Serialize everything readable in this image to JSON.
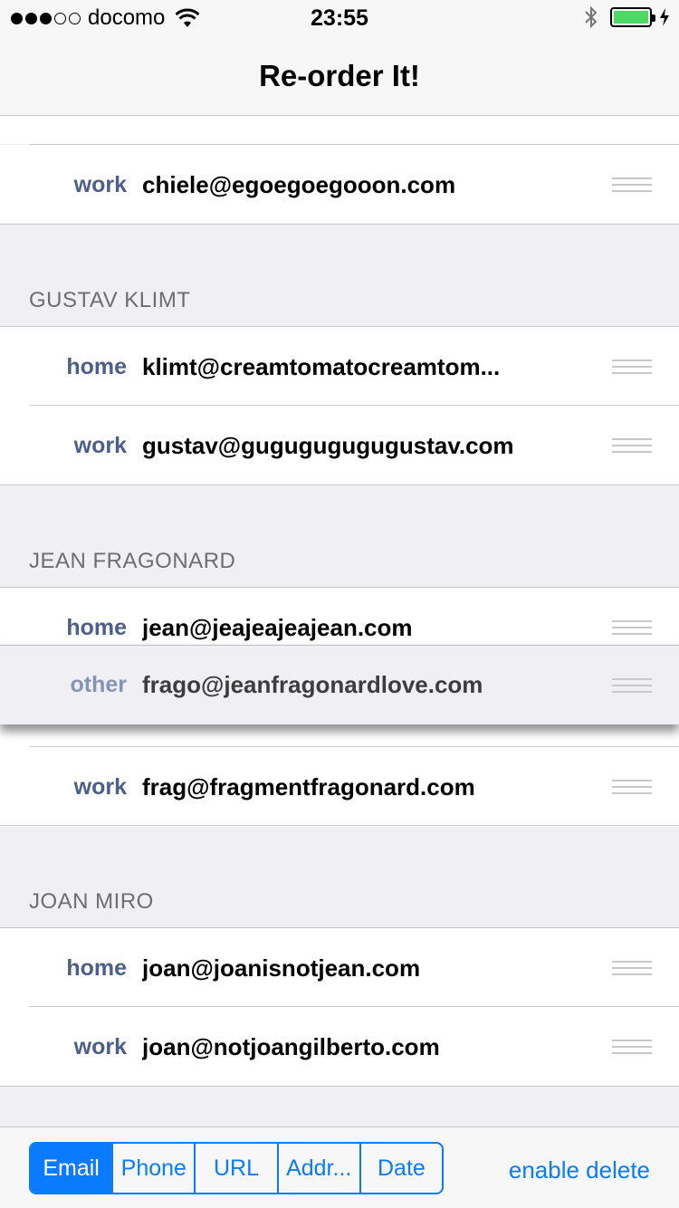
{
  "status_bar": {
    "carrier": "docomo",
    "time": "23:55",
    "signal_bars_filled": 3,
    "signal_bars_total": 5,
    "battery_level": 1.0,
    "battery_color": "#4cd964"
  },
  "nav": {
    "title": "Re-order It!"
  },
  "sections": [
    {
      "cells": [
        {
          "label": "work",
          "value": "chiele@egoegoegooon.com"
        }
      ]
    },
    {
      "header": "GUSTAV KLIMT",
      "cells": [
        {
          "label": "home",
          "value": "klimt@creamtomatocreamtom..."
        },
        {
          "label": "work",
          "value": "gustav@gugugugugugustav.com"
        }
      ]
    },
    {
      "header": "JEAN FRAGONARD",
      "cells": [
        {
          "label": "home",
          "value": "jean@jeajeajeajean.com"
        },
        {
          "label": "work",
          "value": "frag@fragmentfragonard.com"
        }
      ]
    },
    {
      "header": "JOAN MIRO",
      "cells": [
        {
          "label": "home",
          "value": "joan@joanisnotjean.com"
        },
        {
          "label": "work",
          "value": "joan@notjoangilberto.com"
        }
      ]
    }
  ],
  "dragging_cell": {
    "label": "other",
    "value": "frago@jeanfragonardlove.com"
  },
  "toolbar": {
    "segments": [
      "Email",
      "Phone",
      "URL",
      "Addr...",
      "Date"
    ],
    "selected_segment": "Email",
    "enable_delete_label": "enable delete"
  },
  "colors": {
    "accent": "#0a7aff",
    "label": "#4c5f8a",
    "header_text": "#6d6d72",
    "background": "#efeff4"
  },
  "icons": [
    "wifi-icon",
    "bluetooth-icon",
    "battery-icon",
    "charging-icon",
    "reorder-grip-icon"
  ]
}
